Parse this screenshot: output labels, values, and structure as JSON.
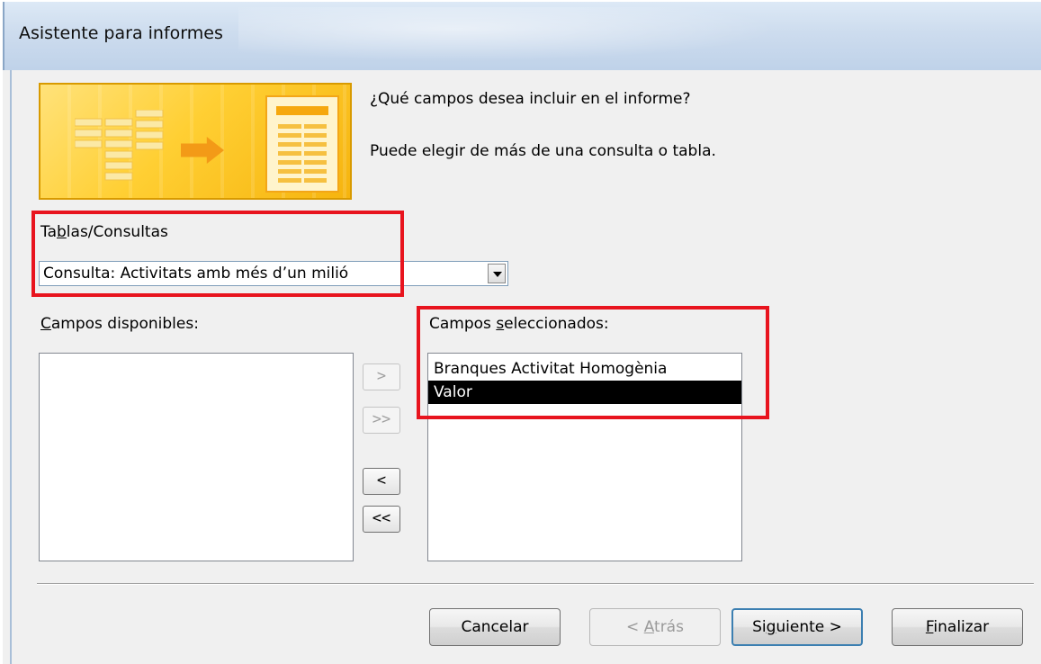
{
  "window": {
    "title": "Asistente para informes"
  },
  "header": {
    "question": "¿Qué campos desea incluir en el informe?",
    "subtext": "Puede elegir de más de una consulta o tabla."
  },
  "source": {
    "label_pre": "Ta",
    "label_ul": "b",
    "label_post": "las/Consultas",
    "selected": "Consulta: Activitats amb més d’un milió"
  },
  "available": {
    "label_ul": "C",
    "label_post": "ampos disponibles:",
    "items": []
  },
  "selected_fields": {
    "label_pre": "Campos ",
    "label_ul": "s",
    "label_post": "eleccionados:",
    "items": [
      {
        "label": "Branques Activitat Homogènia",
        "selected": false
      },
      {
        "label": "Valor",
        "selected": true
      }
    ]
  },
  "move_buttons": {
    "add_one": ">",
    "add_all": ">>",
    "remove_one": "<",
    "remove_all": "<<"
  },
  "footer": {
    "cancel": "Cancelar",
    "back_pre": "< ",
    "back_ul": "A",
    "back_post": "trás",
    "next_pre": "Si",
    "next_ul": "g",
    "next_post": "uiente >",
    "finish_ul": "F",
    "finish_post": "inalizar"
  },
  "colors": {
    "highlight_box": "#e8141e",
    "selection": "#000000"
  }
}
